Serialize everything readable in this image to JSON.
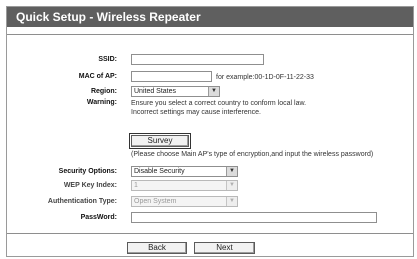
{
  "header": {
    "title": "Quick Setup - Wireless Repeater"
  },
  "form": {
    "ssid": {
      "label": "SSID:",
      "value": ""
    },
    "mac": {
      "label": "MAC of AP:",
      "value": "",
      "hint": "for example:00-1D-0F-11-22-33"
    },
    "region": {
      "label": "Region:",
      "value": "United States"
    },
    "warning": {
      "label": "Warning:",
      "line1": "Ensure you select a correct country to conform local law.",
      "line2": "Incorrect settings may cause interference."
    },
    "survey": {
      "button_label": "Survey",
      "note": "(Please choose Main AP's type of encryption,and input the wireless password)"
    },
    "security_options": {
      "label": "Security Options:",
      "value": "Disable Security"
    },
    "wep_key_index": {
      "label": "WEP Key Index:",
      "value": "1"
    },
    "auth_type": {
      "label": "Authentication Type:",
      "value": "Open System"
    },
    "password": {
      "label": "PassWord:",
      "value": ""
    }
  },
  "footer": {
    "back_label": "Back",
    "next_label": "Next"
  },
  "icons": {
    "dropdown": "dropdown-arrow-icon"
  },
  "colors": {
    "title_bar": "#5f5f5f",
    "title_text": "#ffffff",
    "divider": "#8e8e8e"
  }
}
